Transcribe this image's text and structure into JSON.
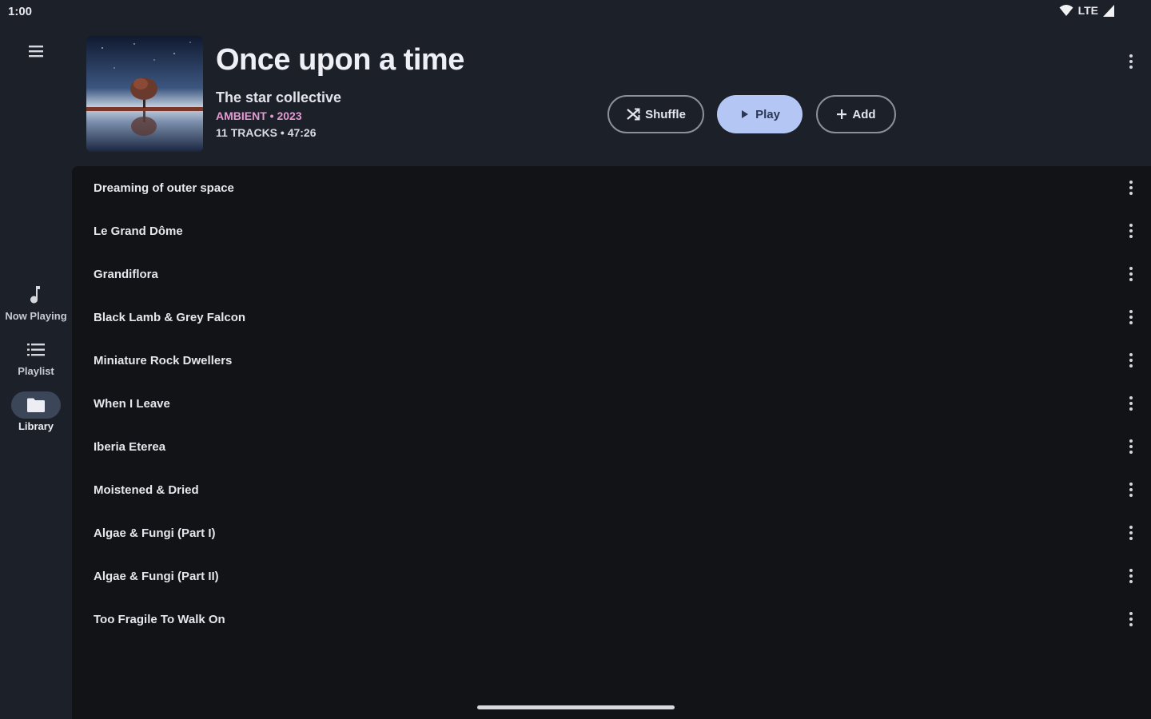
{
  "status_bar": {
    "time": "1:00",
    "network": "LTE"
  },
  "rail": {
    "items": [
      {
        "label": "Now Playing",
        "icon": "music-note-icon",
        "active": false
      },
      {
        "label": "Playlist",
        "icon": "list-icon",
        "active": false
      },
      {
        "label": "Library",
        "icon": "folder-icon",
        "active": true
      }
    ]
  },
  "album": {
    "title": "Once upon a time",
    "artist": "The star collective",
    "genre": "AMBIENT",
    "separator": " • ",
    "year": "2023",
    "stats": "11 TRACKS • 47:26"
  },
  "actions": {
    "shuffle_label": "Shuffle",
    "play_label": "Play",
    "add_label": "Add"
  },
  "tracks": [
    "Dreaming of outer space",
    "Le Grand Dôme",
    "Grandiflora",
    "Black Lamb & Grey Falcon",
    "Miniature Rock Dwellers",
    "When I Leave",
    "Iberia Eterea",
    "Moistened & Dried",
    "Algae & Fungi (Part I)",
    "Algae & Fungi (Part II)",
    "Too Fragile To Walk On"
  ],
  "colors": {
    "background": "#1c2029",
    "list_background": "#121316",
    "accent": "#b4c6f4",
    "genre": "#e69ad2"
  }
}
